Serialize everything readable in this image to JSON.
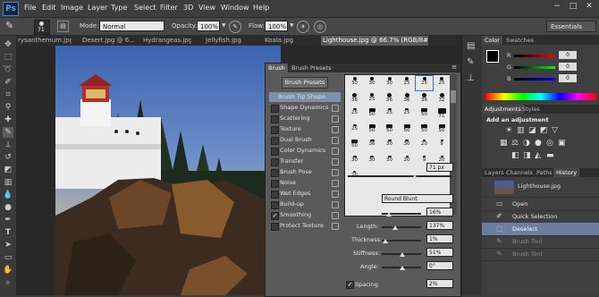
{
  "app": {
    "logo": "Ps",
    "menu": [
      "File",
      "Edit",
      "Image",
      "Layer",
      "Type",
      "Select",
      "Filter",
      "3D",
      "View",
      "Window",
      "Help"
    ],
    "window_controls": [
      "−",
      "□",
      "✕"
    ]
  },
  "options": {
    "brush_size": "71",
    "mode_label": "Mode:",
    "mode_value": "Normal",
    "opacity_label": "Opacity:",
    "opacity_value": "100%",
    "flow_label": "Flow:",
    "flow_value": "100%",
    "workspace": "Essentials"
  },
  "tabs": [
    {
      "label": "rysanthemum.jpg",
      "active": false
    },
    {
      "label": "Desert.jpg @ 6...",
      "active": false
    },
    {
      "label": "Hydrangeas.jpg",
      "active": false
    },
    {
      "label": "Jellyfish.jpg",
      "active": false
    },
    {
      "label": "Koala.jpg",
      "active": false
    },
    {
      "label": "Lighthouse.jpg @ 66.7% (RGB/8#)",
      "active": true
    }
  ],
  "brush_panel": {
    "tabs": [
      "Brush",
      "Brush Presets"
    ],
    "presets_button": "Brush Presets",
    "items": [
      {
        "label": "Brush Tip Shape",
        "checked": false,
        "selected": true
      },
      {
        "label": "Shape Dynamics",
        "checked": false
      },
      {
        "label": "Scattering",
        "checked": false
      },
      {
        "label": "Texture",
        "checked": false
      },
      {
        "label": "Dual Brush",
        "checked": false
      },
      {
        "label": "Color Dynamics",
        "checked": false
      },
      {
        "label": "Transfer",
        "checked": false
      },
      {
        "label": "Brush Pose",
        "checked": false
      },
      {
        "label": "Noise",
        "checked": false
      },
      {
        "label": "Wet Edges",
        "checked": false
      },
      {
        "label": "Build-up",
        "checked": false
      },
      {
        "label": "Smoothing",
        "checked": true
      },
      {
        "label": "Protect Texture",
        "checked": false
      }
    ],
    "grid_numbers": [
      "30",
      "30",
      "30",
      "25",
      "25",
      "25",
      "36",
      "25",
      "36",
      "36",
      "36",
      "32",
      "25",
      "50",
      "25",
      "25",
      "50",
      "71",
      "25",
      "50",
      "50",
      "50",
      "50",
      "50",
      "50",
      "36",
      "30",
      "30",
      "20",
      "9",
      "30",
      "30",
      "30",
      "20",
      "9",
      "20",
      "20"
    ],
    "size_label": "Size",
    "size_value": "71 px",
    "bristle_title": "Bristle Qualities",
    "shape_label": "Shape:",
    "shape_value": "Round Blunt",
    "bristles_label": "Bristles:",
    "bristles_value": "16%",
    "length_label": "Length:",
    "length_value": "137%",
    "thickness_label": "Thickness:",
    "thickness_value": "1%",
    "stiffness_label": "Stiffness:",
    "stiffness_value": "51%",
    "angle_label": "Angle:",
    "angle_value": "0°",
    "spacing_label": "Spacing",
    "spacing_value": "2%"
  },
  "right_panel": {
    "color_tabs": [
      "Color",
      "Swatches"
    ],
    "rgb_labels": [
      "R",
      "G",
      "B"
    ],
    "rgb_values": [
      "0",
      "0",
      "0"
    ],
    "adj_tabs": [
      "Adjustments",
      "Styles"
    ],
    "adj_title": "Add an adjustment",
    "history_tabs": [
      "Layers",
      "Channels",
      "Paths",
      "History"
    ],
    "history_snapshot": "Lighthouse.jpg",
    "history_items": [
      "Open",
      "Quick Selection",
      "Deselect",
      "Brush Tool",
      "Brush Tool"
    ]
  },
  "colors": {
    "accent": "#6a7f9e",
    "selection": "#7d90a9"
  }
}
